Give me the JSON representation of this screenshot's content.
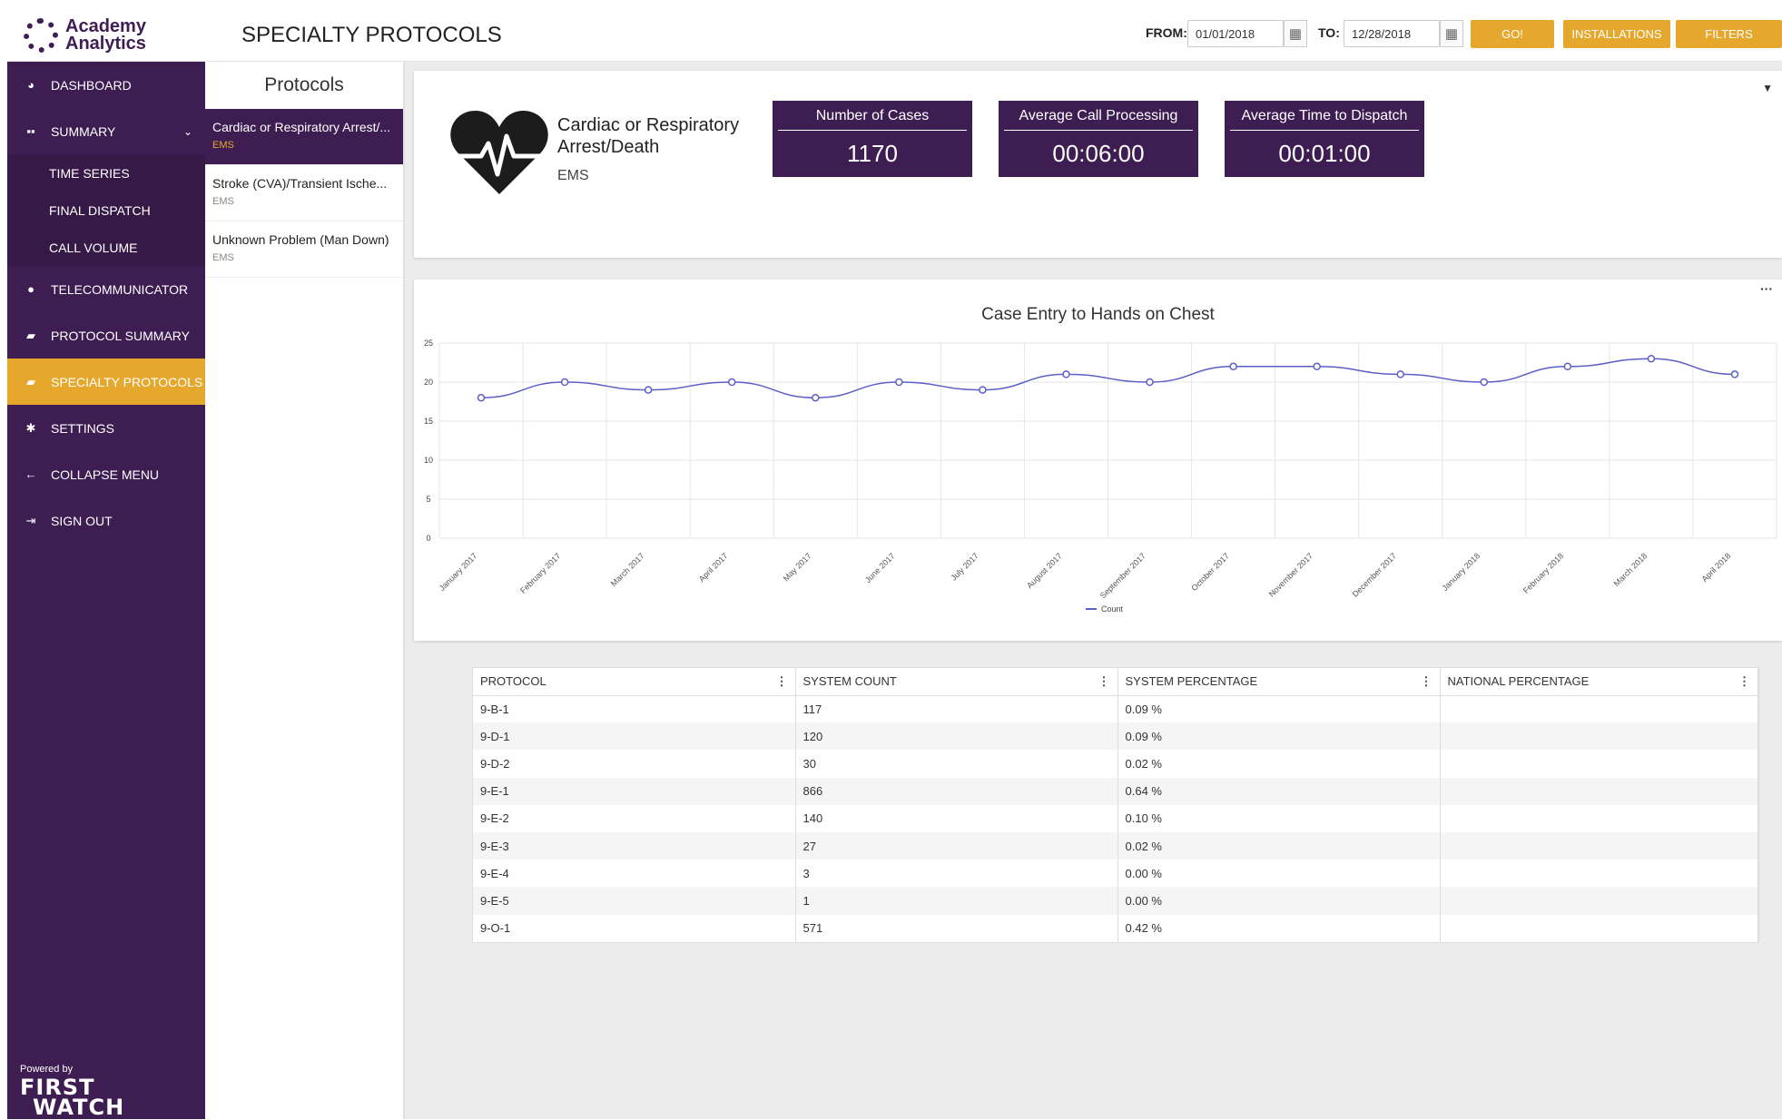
{
  "app": {
    "logo_line1": "Academy",
    "logo_line2": "Analytics",
    "page_title": "SPECIALTY PROTOCOLS"
  },
  "header": {
    "from_label": "FROM:",
    "from_value": "01/01/2018",
    "to_label": "TO:",
    "to_value": "12/28/2018",
    "go_label": "GO!",
    "installations_label": "INSTALLATIONS",
    "filters_label": "FILTERS"
  },
  "nav": {
    "dashboard": "DASHBOARD",
    "summary": "SUMMARY",
    "time_series": "TIME SERIES",
    "final_dispatch": "FINAL DISPATCH",
    "call_volume": "CALL VOLUME",
    "telecommunicator": "TELECOMMUNICATOR",
    "protocol_summary": "PROTOCOL SUMMARY",
    "specialty_protocols": "SPECIALTY PROTOCOLS",
    "settings": "SETTINGS",
    "collapse_menu": "COLLAPSE MENU",
    "sign_out": "SIGN OUT",
    "powered_by": "Powered by",
    "firstwatch_1": "FIRST",
    "firstwatch_2": "WATCH"
  },
  "protocols": {
    "title": "Protocols",
    "items": [
      {
        "name": "Cardiac or Respiratory Arrest/...",
        "category": "EMS"
      },
      {
        "name": "Stroke (CVA)/Transient Ische...",
        "category": "EMS"
      },
      {
        "name": "Unknown Problem (Man Down)",
        "category": "EMS"
      }
    ]
  },
  "summary": {
    "title_line1": "Cardiac or Respiratory",
    "title_line2": "Arrest/Death",
    "category": "EMS",
    "stats": [
      {
        "label": "Number of Cases",
        "value": "1170"
      },
      {
        "label": "Average Call Processing",
        "value": "00:06:00"
      },
      {
        "label": "Average Time to Dispatch",
        "value": "00:01:00"
      }
    ]
  },
  "chart_data": {
    "type": "line",
    "title": "Case Entry to Hands on Chest",
    "categories": [
      "January 2017",
      "February 2017",
      "March 2017",
      "April 2017",
      "May 2017",
      "June 2017",
      "July 2017",
      "August 2017",
      "September 2017",
      "October 2017",
      "November 2017",
      "December 2017",
      "January 2018",
      "February 2018",
      "March 2018",
      "April 2018"
    ],
    "series": [
      {
        "name": "Count",
        "values": [
          18,
          20,
          19,
          20,
          18,
          20,
          19,
          21,
          20,
          22,
          22,
          21,
          20,
          22,
          23,
          21
        ],
        "color": "#5b5fc7"
      }
    ],
    "ylim": [
      0,
      25
    ],
    "yticks": [
      0,
      5,
      10,
      15,
      20,
      25
    ],
    "grid": true,
    "legend": "bottom"
  },
  "table": {
    "headers": [
      "PROTOCOL",
      "SYSTEM COUNT",
      "SYSTEM PERCENTAGE",
      "NATIONAL PERCENTAGE"
    ],
    "rows": [
      [
        "9-B-1",
        "117",
        "0.09 %",
        ""
      ],
      [
        "9-D-1",
        "120",
        "0.09 %",
        ""
      ],
      [
        "9-D-2",
        "30",
        "0.02 %",
        ""
      ],
      [
        "9-E-1",
        "866",
        "0.64 %",
        ""
      ],
      [
        "9-E-2",
        "140",
        "0.10 %",
        ""
      ],
      [
        "9-E-3",
        "27",
        "0.02 %",
        ""
      ],
      [
        "9-E-4",
        "3",
        "0.00 %",
        ""
      ],
      [
        "9-E-5",
        "1",
        "0.00 %",
        ""
      ],
      [
        "9-O-1",
        "571",
        "0.42 %",
        ""
      ]
    ]
  }
}
